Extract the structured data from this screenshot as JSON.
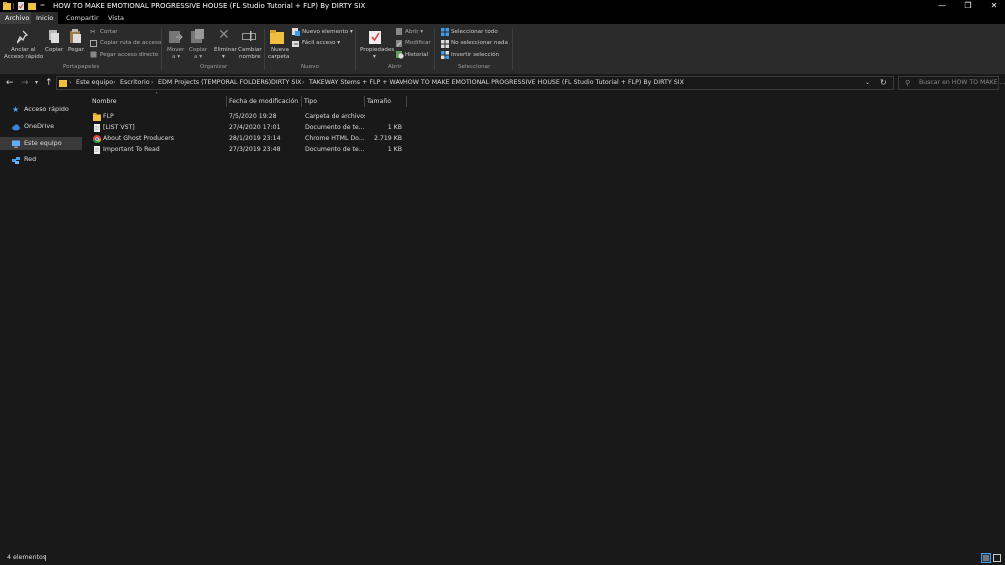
{
  "window": {
    "title": "HOW TO MAKE EMOTIONAL PROGRESSIVE HOUSE (FL Studio Tutorial + FLP) By DIRTY SIX",
    "qa_dropdown": "=",
    "min_glyph": "—",
    "max_glyph": "❐",
    "close_glyph": "✕"
  },
  "ribbon": {
    "tabs": [
      "Archivo",
      "Inicio",
      "Compartir",
      "Vista"
    ],
    "clipboard": {
      "pin_label": "Anclar al\nAcceso rápido",
      "pin_l1": "Anclar al",
      "pin_l2": "Acceso rápido",
      "copy": "Copiar",
      "paste": "Pegar",
      "cut": "Cortar",
      "copy_path": "Copiar ruta de acceso",
      "paste_shortcut": "Pegar acceso directo",
      "group": "Portapapeles"
    },
    "organize": {
      "move_l1": "Mover",
      "move_l2": "a ▾",
      "copy_l1": "Copiar",
      "copy_l2": "a ▾",
      "delete_l1": "Eliminar",
      "delete_l2": "▾",
      "rename_l1": "Cambiar",
      "rename_l2": "nombre",
      "group": "Organizar"
    },
    "new": {
      "folder_l1": "Nueva",
      "folder_l2": "carpeta",
      "new_item": "Nuevo elemento ▾",
      "easy_access": "Fácil acceso ▾",
      "group": "Nuevo"
    },
    "open": {
      "props_l1": "Propiedades",
      "props_l2": "▾",
      "open": "Abrir ▾",
      "modify": "Modificar",
      "history": "Historial",
      "group": "Abrir"
    },
    "select": {
      "all": "Seleccionar todo",
      "none": "No seleccionar nada",
      "invert": "Invertir selección",
      "group": "Seleccionar"
    }
  },
  "address": {
    "crumbs": [
      "Este equipo",
      "Escritorio",
      "EDM Projects (TEMPORAL FOLDERS)",
      "DIRTY SIX",
      "TAKEWAY Stems + FLP + WAV",
      "HOW TO MAKE EMOTIONAL PROGRESSIVE HOUSE (FL Studio Tutorial + FLP) By DIRTY SIX"
    ],
    "search_placeholder": "Buscar en HOW TO MAKE ..."
  },
  "nav": [
    {
      "label": "Acceso rápido",
      "icon": "star-icon",
      "color": "#4aa3f0"
    },
    {
      "label": "OneDrive",
      "icon": "cloud-icon",
      "color": "#3b82d6"
    },
    {
      "label": "Este equipo",
      "icon": "computer-icon",
      "color": "#60b0ff"
    },
    {
      "label": "Red",
      "icon": "network-icon",
      "color": "#4aa3f0"
    }
  ],
  "columns": {
    "name": "Nombre",
    "date": "Fecha de modificación",
    "type": "Tipo",
    "size": "Tamaño"
  },
  "files": [
    {
      "name": "FLP",
      "date": "7/5/2020 19:28",
      "type": "Carpeta de archivos",
      "size": "",
      "icon": "folder-icon"
    },
    {
      "name": "[LIST VST]",
      "date": "27/4/2020 17:01",
      "type": "Documento de te...",
      "size": "1 KB",
      "icon": "text-file-icon"
    },
    {
      "name": "About Ghost Producers",
      "date": "28/1/2019 23:14",
      "type": "Chrome HTML Do...",
      "size": "2.719 KB",
      "icon": "chrome-icon"
    },
    {
      "name": "Important To Read",
      "date": "27/3/2019 23:48",
      "type": "Documento de te...",
      "size": "1 KB",
      "icon": "text-file-icon"
    }
  ],
  "status": {
    "count": "4 elementos"
  },
  "colors": {
    "accent_folder": "#f2c040",
    "select_blue": "#3a9ef0",
    "check_red": "#e04040"
  }
}
